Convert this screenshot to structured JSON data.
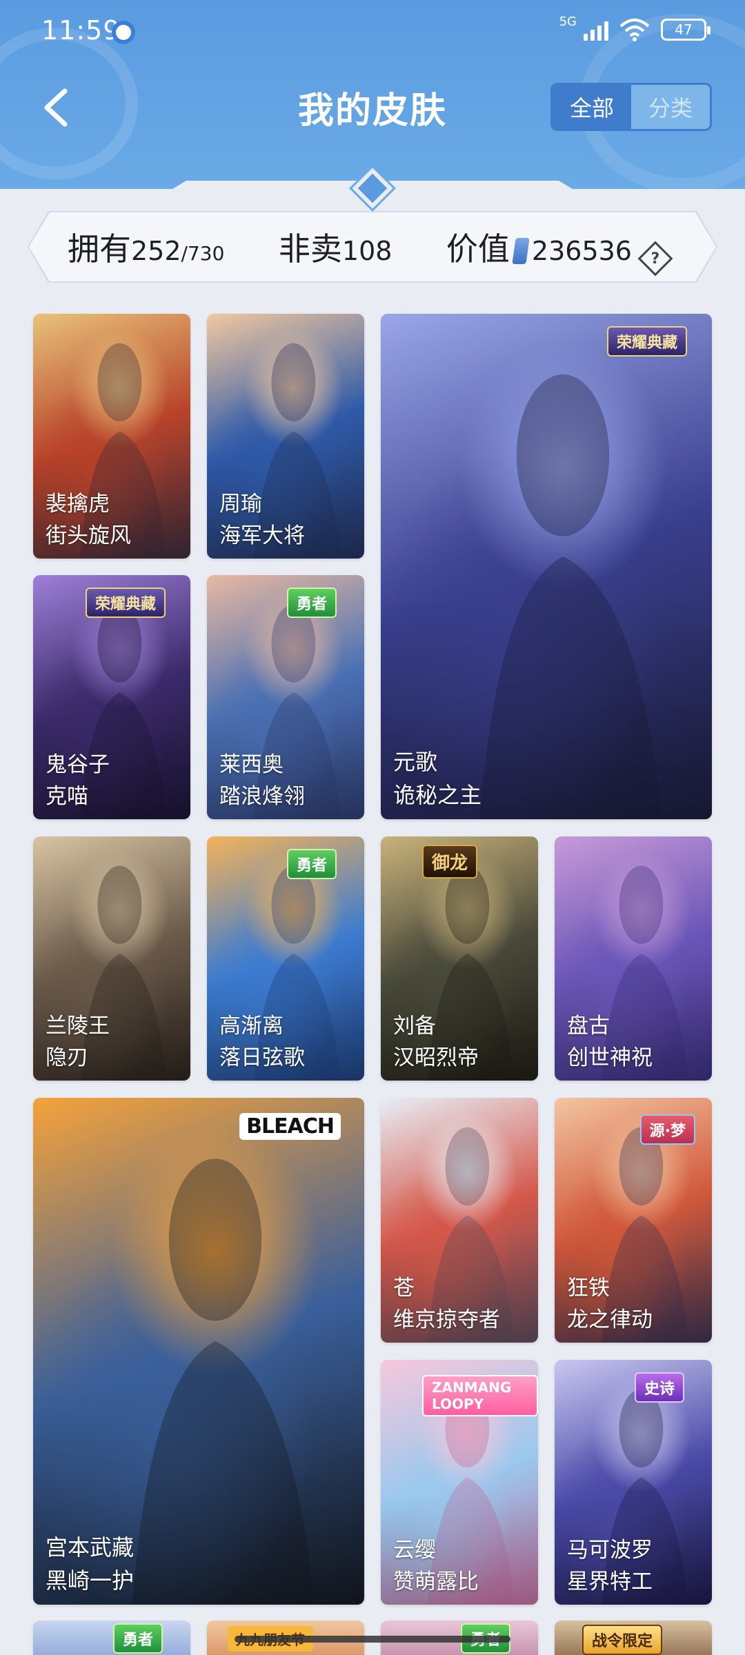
{
  "status_bar": {
    "time": "11:59",
    "network": "5G",
    "battery": "47"
  },
  "header": {
    "title": "我的皮肤",
    "tabs": [
      "全部",
      "分类"
    ],
    "active_tab": "全部"
  },
  "stats": {
    "own_label": "拥有",
    "own_count": "252",
    "own_total": "/730",
    "notsale_label": "非卖",
    "notsale_count": "108",
    "value_label": "价值",
    "value_amount": "236536",
    "help_symbol": "?"
  },
  "skins": [
    {
      "hero": "裴擒虎",
      "skin": "街头旋风",
      "palette": [
        "#e8c27a",
        "#b8432a",
        "#3a2a3a"
      ]
    },
    {
      "hero": "周瑜",
      "skin": "海军大将",
      "palette": [
        "#f1c8a0",
        "#2f5aa8",
        "#22305a"
      ]
    },
    {
      "hero": "元歌",
      "skin": "诡秘之主",
      "palette": [
        "#9aa6e8",
        "#3a3f8e",
        "#1a1c3a"
      ]
    },
    {
      "hero": "鬼谷子",
      "skin": "克喵",
      "palette": [
        "#9d7fd8",
        "#3b2a6a",
        "#1b1433"
      ]
    },
    {
      "hero": "莱西奥",
      "skin": "踏浪烽翎",
      "palette": [
        "#e7b9a1",
        "#4a6fb3",
        "#2d3b6e"
      ]
    },
    {
      "hero": "兰陵王",
      "skin": "隐刃",
      "palette": [
        "#d8c4a2",
        "#6a5a4a",
        "#2a221c"
      ]
    },
    {
      "hero": "高渐离",
      "skin": "落日弦歌",
      "palette": [
        "#f3b35a",
        "#3c7bd0",
        "#1f3f7a"
      ]
    },
    {
      "hero": "刘备",
      "skin": "汉昭烈帝",
      "palette": [
        "#c8b27a",
        "#4a4a3a",
        "#1e1e16"
      ]
    },
    {
      "hero": "盘古",
      "skin": "创世神祝",
      "palette": [
        "#c89ad8",
        "#6a56b8",
        "#3a2e7a"
      ]
    },
    {
      "hero": "宫本武藏",
      "skin": "黑崎一护",
      "palette": [
        "#f5a23a",
        "#3a5f9a",
        "#141820"
      ]
    },
    {
      "hero": "苍",
      "skin": "维京掠夺者",
      "palette": [
        "#e8eef6",
        "#d4584a",
        "#5a4a5a"
      ]
    },
    {
      "hero": "狂铁",
      "skin": "龙之律动",
      "palette": [
        "#f3c4a0",
        "#d0583a",
        "#3a3050"
      ]
    },
    {
      "hero": "云缨",
      "skin": "赞萌露比",
      "palette": [
        "#f6c8dc",
        "#9ac8ee",
        "#c06a9a"
      ]
    },
    {
      "hero": "马可波罗",
      "skin": "星界特工",
      "palette": [
        "#c9c7f0",
        "#4a4aa8",
        "#1c1a48"
      ]
    }
  ],
  "badges": {
    "wenyuan": "荣耀典藏",
    "yongguan": "勇者",
    "royal": "御龙",
    "bleach": "BLEACH",
    "yuanmeng": "源·梦",
    "zanmang": "ZANMANG LOOPY",
    "shishi": "史诗",
    "jiuwu": "九九朋友节",
    "zhanling": "战令限定"
  },
  "colors": {
    "header": "#5a9be0",
    "accent": "#3f7ccc",
    "background": "#e9edf3"
  }
}
